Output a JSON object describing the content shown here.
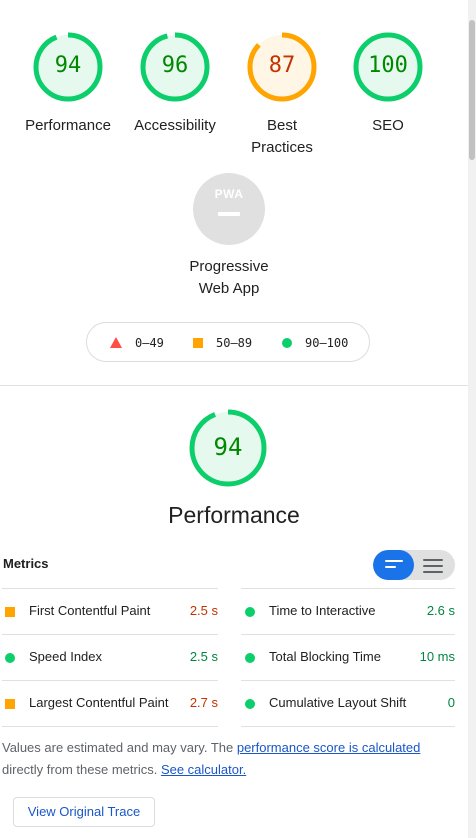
{
  "scores": [
    {
      "label": "Performance",
      "value": "94",
      "score": 0.94,
      "status": "pass"
    },
    {
      "label": "Accessibility",
      "value": "96",
      "score": 0.96,
      "status": "pass"
    },
    {
      "label": "Best Practices",
      "line1": "Best",
      "line2": "Practices",
      "value": "87",
      "score": 0.87,
      "status": "average"
    },
    {
      "label": "SEO",
      "value": "100",
      "score": 1.0,
      "status": "pass"
    }
  ],
  "pwa": {
    "badge": "PWA",
    "line1": "Progressive",
    "line2": "Web App"
  },
  "legend": {
    "fail": "0–49",
    "average": "50–89",
    "pass": "90–100"
  },
  "performance": {
    "score": "94",
    "title": "Performance"
  },
  "metrics": {
    "heading": "Metrics",
    "items": [
      {
        "name": "First Contentful Paint",
        "value": "2.5 s",
        "status": "average"
      },
      {
        "name": "Time to Interactive",
        "value": "2.6 s",
        "status": "pass"
      },
      {
        "name": "Speed Index",
        "value": "2.5 s",
        "status": "pass"
      },
      {
        "name": "Total Blocking Time",
        "value": "10 ms",
        "status": "pass"
      },
      {
        "name": "Largest Contentful Paint",
        "value": "2.7 s",
        "status": "average"
      },
      {
        "name": "Cumulative Layout Shift",
        "value": "0",
        "status": "pass"
      }
    ]
  },
  "note": {
    "text1": "Values are estimated and may vary. The ",
    "link1": "performance score is calculated",
    "text2": " directly from these metrics. ",
    "link2": "See calculator."
  },
  "trace_button": "View Original Trace",
  "colors": {
    "pass": "#0cce6b",
    "pass_fill": "#e6f9ee",
    "pass_text": "#008800",
    "average": "#ffa400",
    "average_fill": "#fff6e6",
    "average_text": "#c33300",
    "fail": "#ff4e42"
  }
}
